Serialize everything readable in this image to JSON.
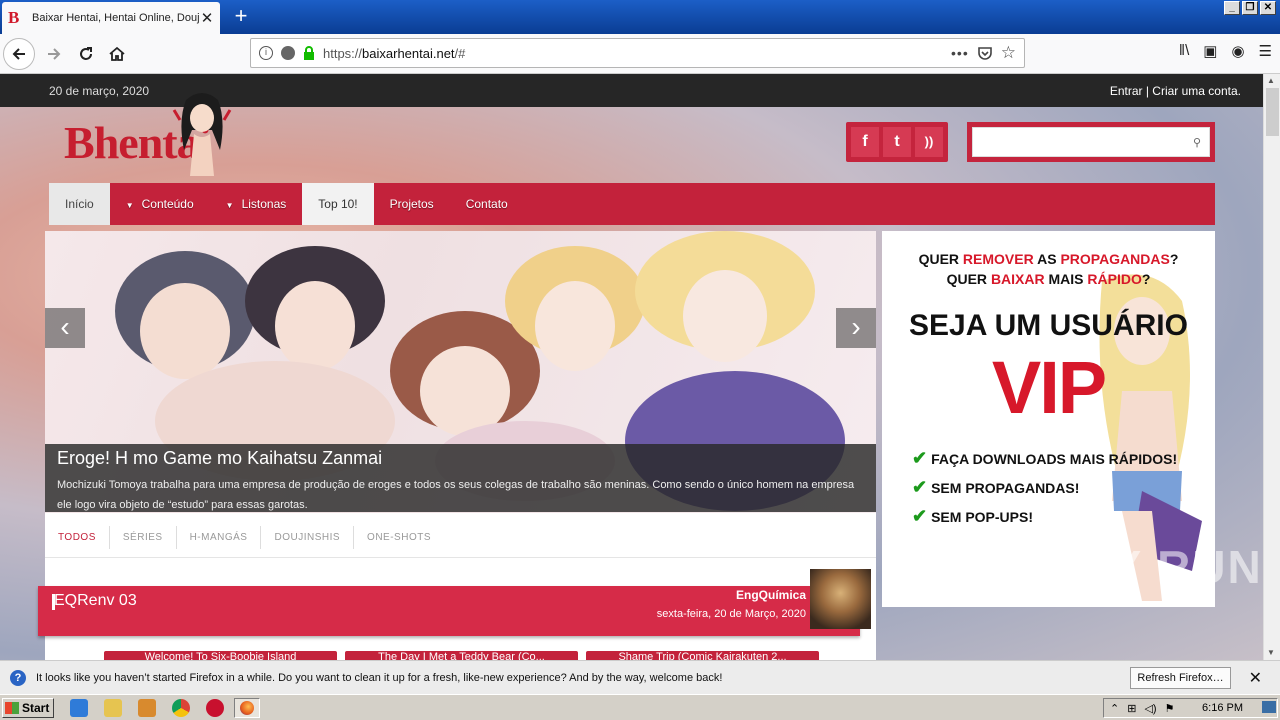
{
  "browser": {
    "tab_title": "Baixar Hentai, Hentai Online, Douj",
    "tab_favicon_letter": "B",
    "new_tab_symbol": "+",
    "url_prefix": "https://",
    "url_domain": "baixarhentai.net",
    "url_path": "/#",
    "window_buttons": [
      "_",
      "❐",
      "✕"
    ]
  },
  "site": {
    "date": "20 de março, 2020",
    "login": "Entrar | Criar uma conta.",
    "logo_b": "B",
    "logo_rest": "hentai",
    "social": [
      "f",
      "t",
      "rss"
    ],
    "menu": [
      {
        "label": "Início",
        "dropdown": false
      },
      {
        "label": "Conteúdo",
        "dropdown": true
      },
      {
        "label": "Listonas",
        "dropdown": true
      },
      {
        "label": "Top 10!",
        "dropdown": false
      },
      {
        "label": "Projetos",
        "dropdown": false
      },
      {
        "label": "Contato",
        "dropdown": false
      }
    ]
  },
  "slider": {
    "title": "Eroge! H mo Game mo Kaihatsu Zanmai",
    "description": "Mochizuki Tomoya trabalha para uma empresa de produção de eroges e todos os seus colegas de trabalho são meninas. Como sendo o único homem na empresa ele logo vira objeto de “estudo” para essas garotas.",
    "prev": "‹",
    "next": "›"
  },
  "ad": {
    "line1_a": "QUER ",
    "line1_red1": "REMOVER",
    "line1_b": " AS ",
    "line1_red2": "PROPAGANDAS",
    "line1_c": "?",
    "line2_a": "QUER ",
    "line2_red1": "BAIXAR",
    "line2_b": " MAIS ",
    "line2_red2": "RÁPIDO",
    "line2_c": "?",
    "headline": "SEJA UM USUÁRIO",
    "vip": "VIP",
    "features": [
      "FAÇA DOWNLOADS MAIS RÁPIDOS!",
      "SEM PROPAGANDAS!",
      "SEM POP-UPS!"
    ]
  },
  "filters": [
    "TODOS",
    "SÉRIES",
    "H-MANGÁS",
    "DOUJINSHIS",
    "ONE-SHOTS"
  ],
  "post": {
    "title": "EQRenv 03",
    "author": "EngQuímica",
    "date": "sexta-feira, 20 de Março, 2020"
  },
  "related": [
    "Welcome! To Six-Boobie Island",
    "The Day I Met a Teddy Bear (Co...",
    "Shame Trip (Comic Kairakuten 2..."
  ],
  "watermark": "ANY RUN",
  "notification": {
    "text": "It looks like you haven’t started Firefox in a while. Do you want to clean it up for a fresh, like-new experience? And by the way, welcome back!",
    "button": "Refresh Firefox…",
    "close": "✕"
  },
  "taskbar": {
    "start": "Start",
    "clock": "6:16 PM"
  }
}
